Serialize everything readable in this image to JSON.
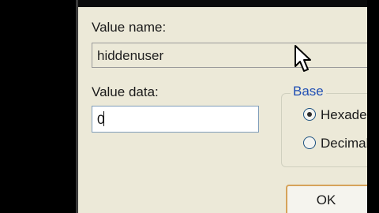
{
  "dialog": {
    "value_name": {
      "label": "Value name:",
      "value": "hiddenuser"
    },
    "value_data": {
      "label": "Value data:",
      "value": "0"
    },
    "base": {
      "legend": "Base",
      "options": [
        {
          "label": "Hexadec",
          "selected": true
        },
        {
          "label": "Decimal",
          "selected": false
        }
      ]
    },
    "ok_label": "OK"
  },
  "icons": {
    "cursor": "mouse-pointer-icon",
    "radio_on": "radio-selected-icon",
    "radio_off": "radio-unselected-icon"
  },
  "colors": {
    "dialog_bg": "#ece9d8",
    "legend_text": "#1f4eb4",
    "ok_border": "#d6a35a",
    "field_border": "#7f9db9"
  }
}
